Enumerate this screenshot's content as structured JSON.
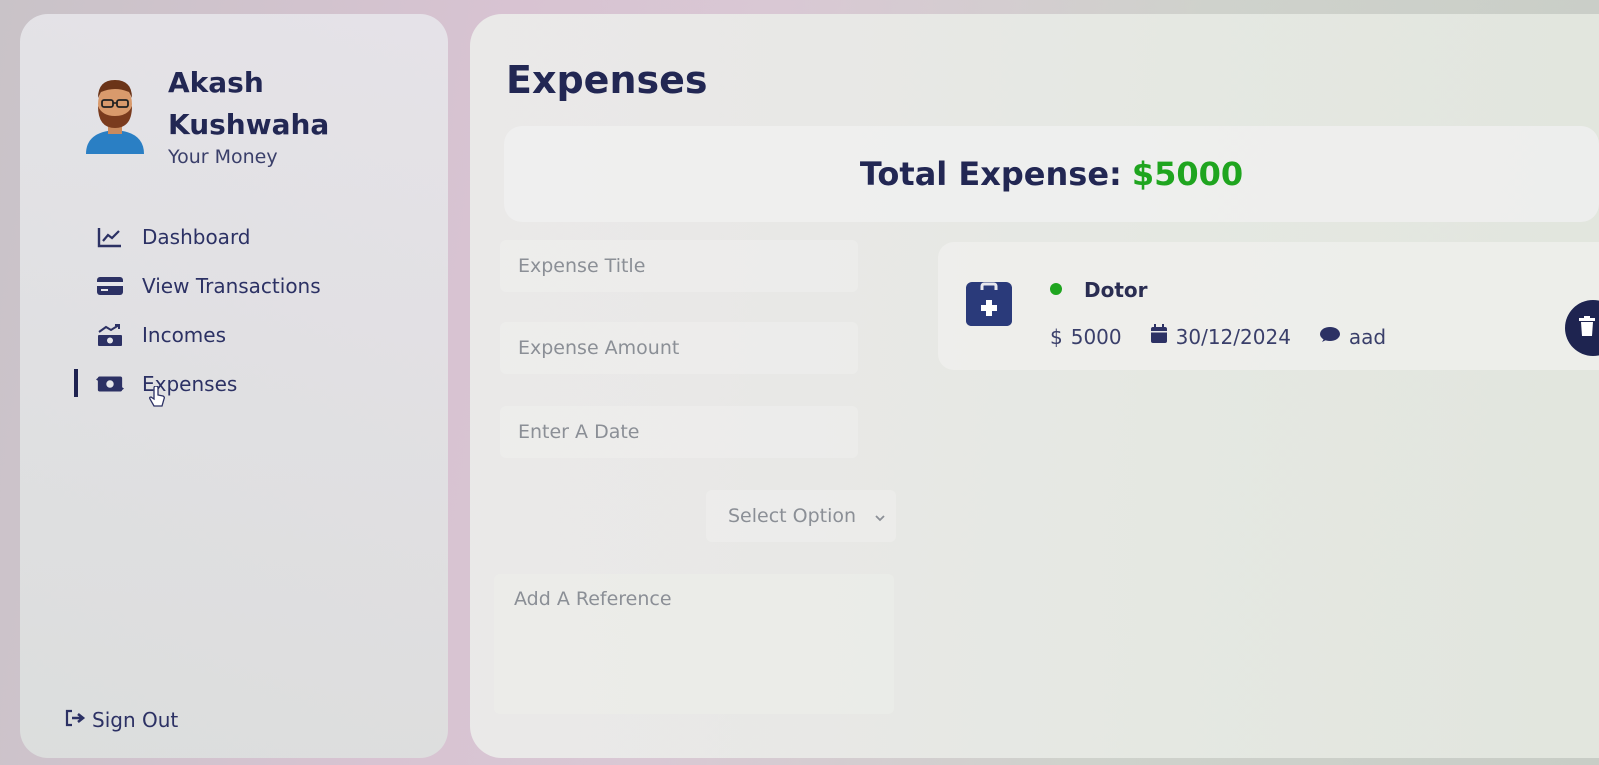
{
  "user": {
    "name": "Akash Kushwaha",
    "subtitle": "Your Money"
  },
  "nav": {
    "items": [
      {
        "label": "Dashboard",
        "icon": "chart-line-icon"
      },
      {
        "label": "View Transactions",
        "icon": "credit-card-icon"
      },
      {
        "label": "Incomes",
        "icon": "money-trend-icon"
      },
      {
        "label": "Expenses",
        "icon": "money-bill-transfer-icon",
        "active": true
      }
    ],
    "sign_out": "Sign Out"
  },
  "main": {
    "title": "Expenses",
    "total_label": "Total Expense:",
    "total_amount": "$5000",
    "form": {
      "title_placeholder": "Expense Title",
      "amount_placeholder": "Expense Amount",
      "date_placeholder": "Enter A Date",
      "select_placeholder": "Select Option",
      "reference_placeholder": "Add A Reference"
    },
    "expenses": [
      {
        "title": "Dotor",
        "amount": "5000",
        "currency_symbol": "$",
        "date": "30/12/2024",
        "note": "aad",
        "icon": "medical-kit-icon"
      }
    ]
  },
  "colors": {
    "accent": "#222753",
    "positive": "#1fa51f",
    "delete_bg": "#1e2450"
  }
}
